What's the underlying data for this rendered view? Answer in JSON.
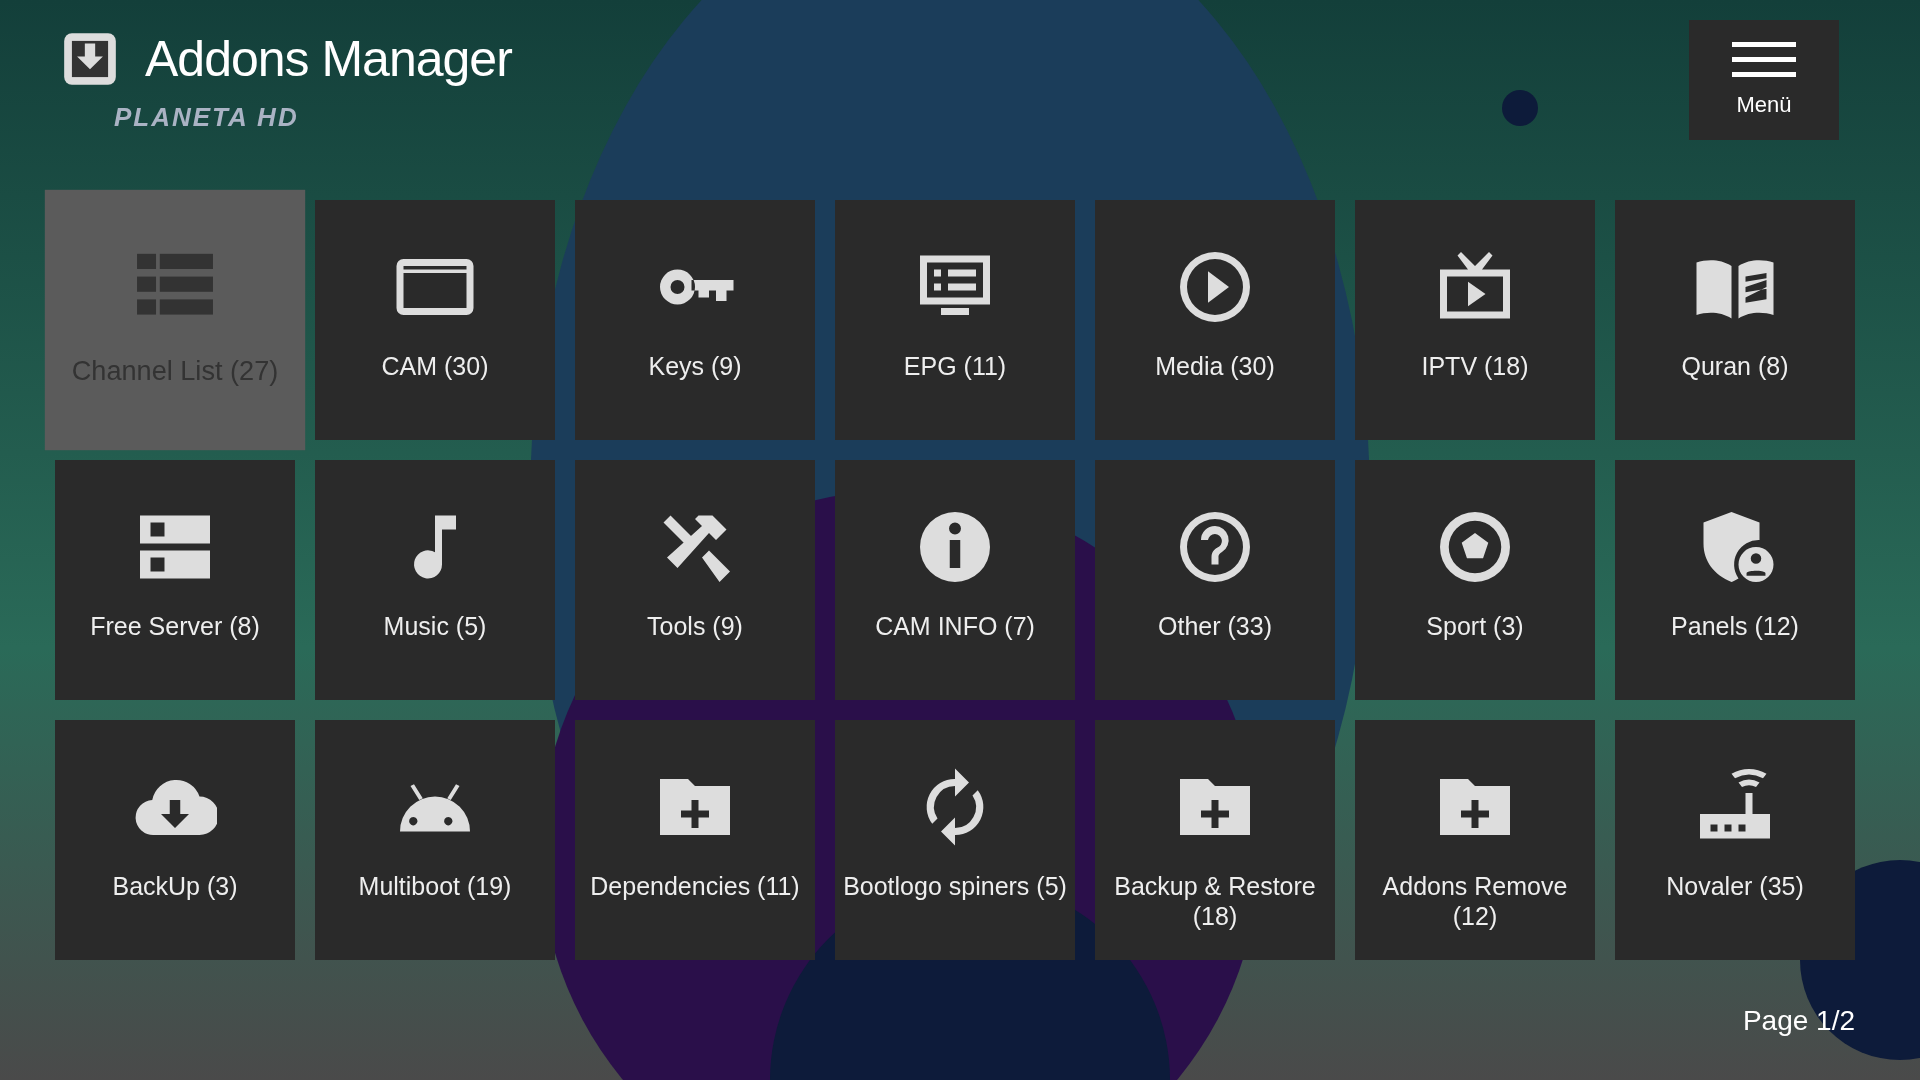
{
  "header": {
    "title": "Addons Manager",
    "logo": "PLANETA HD"
  },
  "menu_button": {
    "label": "Menü"
  },
  "tiles": [
    {
      "label": "Channel List (27)",
      "selected": true
    },
    {
      "label": "CAM (30)",
      "selected": false
    },
    {
      "label": "Keys (9)",
      "selected": false
    },
    {
      "label": "EPG (11)",
      "selected": false
    },
    {
      "label": "Media (30)",
      "selected": false
    },
    {
      "label": "IPTV (18)",
      "selected": false
    },
    {
      "label": "Quran (8)",
      "selected": false
    },
    {
      "label": "Free Server (8)",
      "selected": false
    },
    {
      "label": "Music (5)",
      "selected": false
    },
    {
      "label": "Tools (9)",
      "selected": false
    },
    {
      "label": "CAM INFO (7)",
      "selected": false
    },
    {
      "label": "Other (33)",
      "selected": false
    },
    {
      "label": "Sport (3)",
      "selected": false
    },
    {
      "label": "Panels (12)",
      "selected": false
    },
    {
      "label": "BackUp (3)",
      "selected": false
    },
    {
      "label": "Multiboot (19)",
      "selected": false
    },
    {
      "label": "Dependencies (11)",
      "selected": false
    },
    {
      "label": "Bootlogo spiners (5)",
      "selected": false
    },
    {
      "label": "Backup & Restore (18)",
      "selected": false
    },
    {
      "label": "Addons Remove (12)",
      "selected": false
    },
    {
      "label": "Novaler (35)",
      "selected": false
    }
  ],
  "page_indicator": "Page 1/2"
}
